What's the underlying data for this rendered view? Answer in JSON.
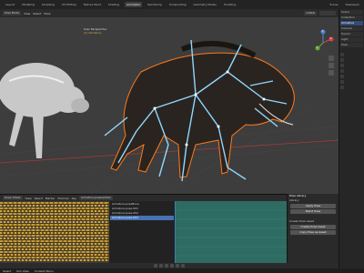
{
  "menu": {
    "workspaces": [
      "Layout",
      "Modeling",
      "Sculpting",
      "UV Editing",
      "Texture Paint",
      "Shading",
      "Animation",
      "Rendering",
      "Compositing",
      "Geometry Nodes",
      "Scripting"
    ],
    "active_workspace": "Animation",
    "scene_label": "Scene",
    "view_layer_label": "ViewLayer"
  },
  "viewport": {
    "mode": "Pose Mode",
    "menu_view": "View",
    "menu_select": "Select",
    "menu_pose": "Pose",
    "transform_orientation": "Global",
    "overlay_title": "User Perspective",
    "overlay_sub": "(1) Armature",
    "axis_x": "X",
    "axis_y": "Y",
    "axis_z": "Z"
  },
  "outliner": {
    "items": [
      "Scene Collection",
      "Collection",
      "Armature",
      "Camera",
      "Hyena",
      "Light",
      "Pose"
    ]
  },
  "timeline": {
    "editor": "Dope Sheet",
    "menu_view": "View",
    "menu_select": "Select",
    "menu_marker": "Marker",
    "menu_channel": "Channel",
    "menu_key": "Key",
    "action_name": "Armature.posesAction",
    "pose_items": [
      "Armature.poseBone",
      "Armature.pose.001",
      "Armature.pose.002",
      "Armature.pose.003"
    ],
    "selected_pose": 3
  },
  "pose_panel": {
    "tab": "Pose Library",
    "sec_library": "Library",
    "sec_create": "Create Pose Asset",
    "btn_create": "Create Pose Asset",
    "btn_copy": "Copy Pose as Asset",
    "btn_apply": "Apply Pose",
    "btn_blend": "Blend Pose"
  },
  "status": {
    "left": "Select",
    "mid": "Pan View",
    "right": "Context Menu"
  },
  "colors": {
    "accent": "#4772b3",
    "bone": "#8fd8ff",
    "outline": "#ff7a1a",
    "keyframe": "#c79a2e"
  }
}
